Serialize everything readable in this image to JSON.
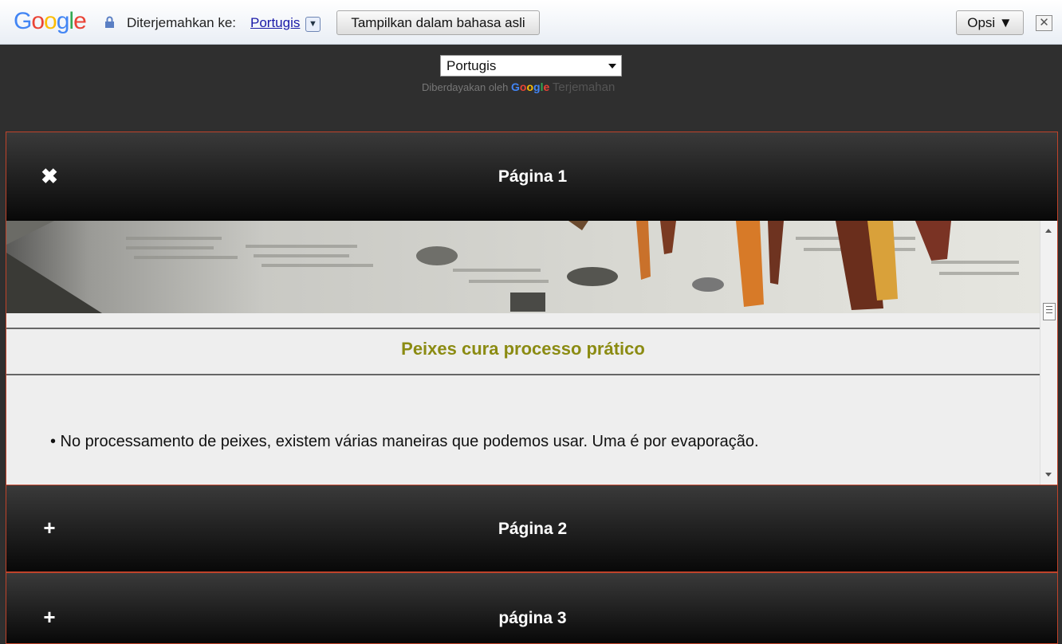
{
  "translate_bar": {
    "logo": "Google",
    "translated_to_label": "Diterjemahkan ke:",
    "language": "Portugis",
    "show_original_button": "Tampilkan dalam bahasa asli",
    "options_button": "Opsi ▼",
    "close": "✕"
  },
  "language_widget": {
    "selected": "Portugis",
    "powered_by": "Diberdayakan oleh",
    "powered_google": "Google",
    "powered_translate": "Terjemahan"
  },
  "accordion": {
    "pages": [
      {
        "icon": "✖",
        "title": "Página 1",
        "expanded": true
      },
      {
        "icon": "+",
        "title": "Página 2",
        "expanded": false
      },
      {
        "icon": "+",
        "title": "página 3",
        "expanded": false
      }
    ]
  },
  "content": {
    "heading": "Peixes cura processo prático",
    "bullet": "• No processamento de peixes, existem várias maneiras que podemos usar. Uma é por evaporação."
  },
  "colors": {
    "accent_border": "#c0432a",
    "heading": "#8b8b12",
    "background": "#2f2f2f"
  }
}
